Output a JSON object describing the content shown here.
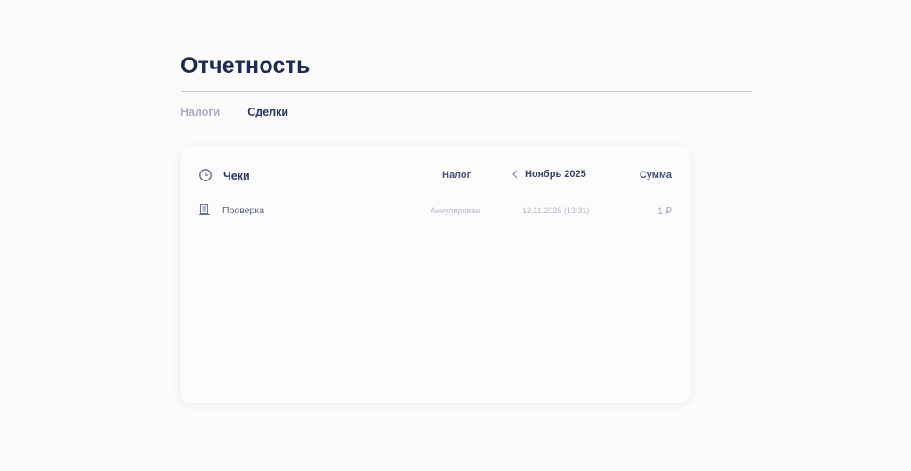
{
  "page": {
    "title": "Отчетность"
  },
  "tabs": [
    {
      "label": "Налоги",
      "active": false
    },
    {
      "label": "Сделки",
      "active": true
    }
  ],
  "table": {
    "header": {
      "receipts_label": "Чеки",
      "tax_label": "Налог",
      "month_label": "Ноябрь 2025",
      "sum_label": "Сумма"
    },
    "rows": [
      {
        "name": "Проверка",
        "status": "Аннулирован",
        "date": "12.11.2025 (13:31)",
        "sum": "1 ₽"
      }
    ]
  },
  "icons": {
    "clock": "clock-icon",
    "prev_month": "chevron-left-icon",
    "receipt": "receipt-icon"
  },
  "colors": {
    "title": "#1e2b57",
    "tab_active": "#2a3560",
    "tab_inactive": "#a9afbf",
    "muted": "#b3b8c6"
  }
}
